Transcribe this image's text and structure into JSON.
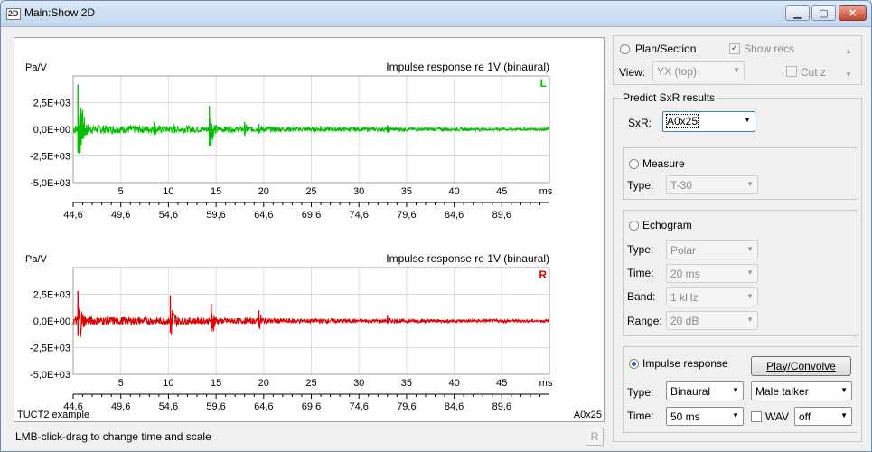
{
  "window": {
    "title": "Main:Show 2D",
    "icon_text": "2D",
    "buttons": {
      "minimize": "▁",
      "maximize": "▢",
      "close": "✕"
    }
  },
  "status": {
    "hint": "LMB-click-drag to change time and scale",
    "r_button": "R"
  },
  "panel": {
    "plan_section": {
      "label": "Plan/Section",
      "selected": false
    },
    "show_recs": {
      "label": "Show recs",
      "checked": true
    },
    "view": {
      "label": "View:",
      "value": "YX (top)"
    },
    "cut_z": {
      "label": "Cut z",
      "checked": false
    },
    "predict_title": "Predict SxR results",
    "sxr": {
      "label": "SxR:",
      "value": "A0x25"
    },
    "measure": {
      "label": "Measure",
      "type_label": "Type:",
      "type_value": "T-30"
    },
    "echogram": {
      "label": "Echogram",
      "type_label": "Type:",
      "type_value": "Polar",
      "time_label": "Time:",
      "time_value": "20 ms",
      "band_label": "Band:",
      "band_value": "1 kHz",
      "range_label": "Range:",
      "range_value": "20 dB"
    },
    "impulse": {
      "label": "Impulse response",
      "selected": true,
      "play_button": "Play/Convolve",
      "type_label": "Type:",
      "type_value": "Binaural",
      "talker_value": "Male talker",
      "time_label": "Time:",
      "time_value": "50 ms",
      "wav_label": "WAV",
      "wav_value": "off"
    }
  },
  "chart_data": [
    {
      "type": "line",
      "title": "Impulse response re 1V (binaural)",
      "ylabel": "Pa/V",
      "channel": "L",
      "color": "#00c000",
      "ylim": [
        -5000,
        5000
      ],
      "yticks": [
        "2,5E+03",
        "0,0E+00",
        "-2,5E+03",
        "-5,0E+03"
      ],
      "xlabel": "ms",
      "xlim": [
        0,
        50
      ],
      "xticks": [
        "5",
        "10",
        "15",
        "20",
        "25",
        "30",
        "35",
        "40",
        "45"
      ],
      "abs_ticks": [
        "44,6",
        "49,6",
        "54,6",
        "59,6",
        "64,6",
        "69,6",
        "74,6",
        "79,6",
        "84,6",
        "89,6"
      ],
      "spikes": [
        {
          "t": 0.5,
          "max": 4200,
          "min": -2200
        },
        {
          "t": 1.0,
          "max": 1800,
          "min": -900
        },
        {
          "t": 8.5,
          "max": 700,
          "min": -400
        },
        {
          "t": 10.5,
          "max": 600,
          "min": -400
        },
        {
          "t": 14.3,
          "max": 2200,
          "min": -1600
        },
        {
          "t": 18.0,
          "max": 700,
          "min": -500
        },
        {
          "t": 19.5,
          "max": 500,
          "min": -400
        },
        {
          "t": 26.0,
          "max": 300,
          "min": -200
        },
        {
          "t": 33.0,
          "max": 400,
          "min": -300
        }
      ]
    },
    {
      "type": "line",
      "title": "Impulse response re 1V (binaural)",
      "ylabel": "Pa/V",
      "channel": "R",
      "color": "#dd0000",
      "ylim": [
        -5000,
        5000
      ],
      "yticks": [
        "2,5E+03",
        "0,0E+00",
        "-2,5E+03",
        "-5,0E+03"
      ],
      "xlabel": "ms",
      "xlim": [
        0,
        50
      ],
      "xticks": [
        "5",
        "10",
        "15",
        "20",
        "25",
        "30",
        "35",
        "40",
        "45"
      ],
      "abs_ticks": [
        "44,6",
        "49,6",
        "54,6",
        "59,6",
        "64,6",
        "69,6",
        "74,6",
        "79,6",
        "84,6",
        "89,6"
      ],
      "spikes": [
        {
          "t": 0.5,
          "max": 2800,
          "min": -1400
        },
        {
          "t": 10.2,
          "max": 2400,
          "min": -1100
        },
        {
          "t": 14.5,
          "max": 1600,
          "min": -1000
        },
        {
          "t": 19.5,
          "max": 1000,
          "min": -600
        },
        {
          "t": 33.0,
          "max": 500,
          "min": -200
        }
      ]
    }
  ],
  "footer": {
    "example": "TUCT2 example",
    "sxr": "A0x25"
  }
}
